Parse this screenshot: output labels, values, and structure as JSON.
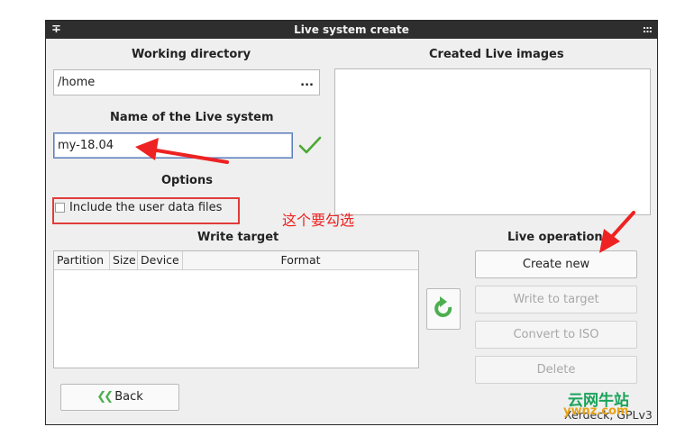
{
  "window": {
    "title": "Live system create",
    "left_glyph": "∓",
    "right_glyph": ":::"
  },
  "left": {
    "working_directory_label": "Working directory",
    "working_directory_value": "/home",
    "browse_label": "...",
    "name_label": "Name of the Live system",
    "name_value": "my-18.04",
    "options_label": "Options",
    "include_user_data_label": "Include the user data files",
    "include_user_data_checked": false,
    "write_target_label": "Write target",
    "table_headers": [
      "Partition",
      "Size",
      "Device",
      "Format"
    ],
    "back_label": "Back"
  },
  "right": {
    "created_images_label": "Created Live images",
    "live_operations_label": "Live operations",
    "buttons": [
      "Create new",
      "Write to target",
      "Convert to ISO",
      "Delete"
    ],
    "footer_text": "Xerdeck, GPLv3"
  },
  "annotation": {
    "text": "这个要勾选",
    "color": "#e22222"
  },
  "watermark": {
    "line1": "云网牛站",
    "line2": "ywnz.com"
  },
  "colors": {
    "accent_green": "#4caf50",
    "check_green": "#4aa832",
    "title_bg": "#2e2e2e"
  }
}
